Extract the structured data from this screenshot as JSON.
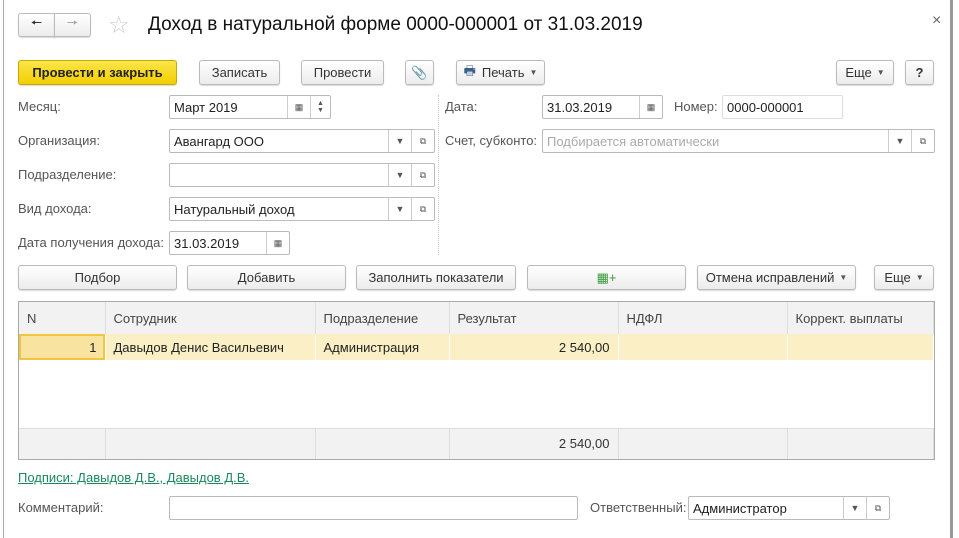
{
  "header": {
    "title": "Доход в натуральной форме 0000-000001 от 31.03.2019"
  },
  "toolbar": {
    "post_close": "Провести и закрыть",
    "save": "Записать",
    "post": "Провести",
    "print": "Печать",
    "more": "Еще",
    "help": "?"
  },
  "form": {
    "month_label": "Месяц:",
    "month_value": "Март 2019",
    "org_label": "Организация:",
    "org_value": "Авангард ООО",
    "dept_label": "Подразделение:",
    "dept_value": "",
    "income_type_label": "Вид дохода:",
    "income_type_value": "Натуральный доход",
    "income_date_label": "Дата получения дохода:",
    "income_date_value": "31.03.2019",
    "date_label": "Дата:",
    "date_value": "31.03.2019",
    "number_label": "Номер:",
    "number_value": "0000-000001",
    "account_label": "Счет, субконто:",
    "account_placeholder": "Подбирается автоматически"
  },
  "table_toolbar": {
    "select": "Подбор",
    "add": "Добавить",
    "fill": "Заполнить показатели",
    "cancel_corrections": "Отмена исправлений",
    "more": "Еще"
  },
  "table": {
    "columns": [
      "N",
      "Сотрудник",
      "Подразделение",
      "Результат",
      "НДФЛ",
      "Коррект. выплаты"
    ],
    "rows": [
      [
        "1",
        "Давыдов Денис Васильевич",
        "Администрация",
        "2 540,00",
        "",
        ""
      ]
    ],
    "totals": {
      "result": "2 540,00"
    }
  },
  "footer": {
    "signatures": "Подписи: Давыдов Д.В., Давыдов Д.В.",
    "comment_label": "Комментарий:",
    "comment_value": "",
    "responsible_label": "Ответственный:",
    "responsible_value": "Администратор"
  }
}
